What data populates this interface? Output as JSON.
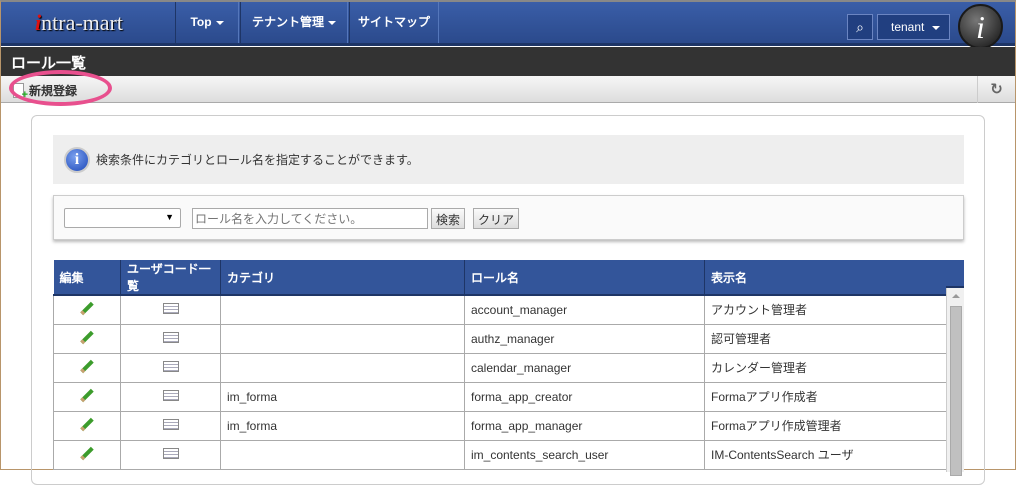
{
  "header": {
    "logo": "intra-mart",
    "nav": [
      {
        "label": "Top"
      },
      {
        "label": "テナント管理"
      },
      {
        "label": "サイトマップ"
      }
    ],
    "user": "tenant",
    "avatar_letter": "i"
  },
  "page_title": "ロール一覧",
  "toolbar": {
    "new_label": "新規登録",
    "refresh_icon": "refresh-icon"
  },
  "info": {
    "text": "検索条件にカテゴリとロール名を指定することができます。"
  },
  "search": {
    "category_value": "",
    "role_placeholder": "ロール名を入力してください。",
    "search_label": "検索",
    "clear_label": "クリア"
  },
  "table": {
    "columns": [
      "編集",
      "ユーザコード一覧",
      "カテゴリ",
      "ロール名",
      "表示名"
    ],
    "rows": [
      {
        "category": "",
        "role": "account_manager",
        "display": "アカウント管理者"
      },
      {
        "category": "",
        "role": "authz_manager",
        "display": "認可管理者"
      },
      {
        "category": "",
        "role": "calendar_manager",
        "display": "カレンダー管理者"
      },
      {
        "category": "im_forma",
        "role": "forma_app_creator",
        "display": "Formaアプリ作成者"
      },
      {
        "category": "im_forma",
        "role": "forma_app_manager",
        "display": "Formaアプリ作成管理者"
      },
      {
        "category": "",
        "role": "im_contents_search_user",
        "display": "IM-ContentsSearch ユーザ"
      }
    ]
  },
  "colors": {
    "header": "#2b4a8c",
    "highlight": "#e8508e"
  }
}
